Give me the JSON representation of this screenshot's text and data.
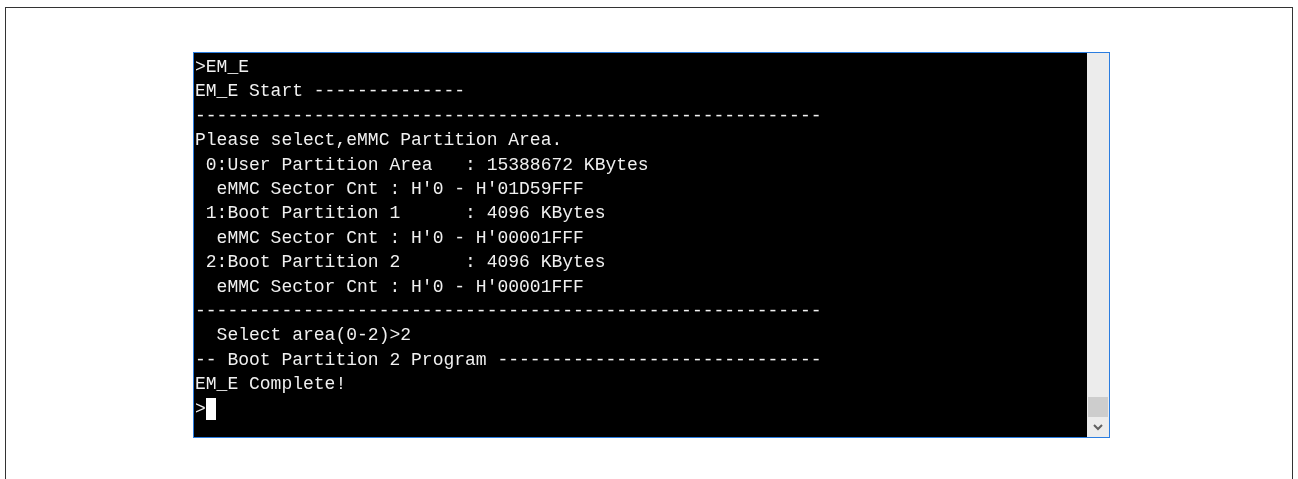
{
  "console": {
    "lines": [
      ">EM_E",
      "EM_E Start --------------",
      "----------------------------------------------------------",
      "Please select,eMMC Partition Area.",
      " 0:User Partition Area   : 15388672 KBytes",
      "  eMMC Sector Cnt : H'0 - H'01D59FFF",
      " 1:Boot Partition 1      : 4096 KBytes",
      "  eMMC Sector Cnt : H'0 - H'00001FFF",
      " 2:Boot Partition 2      : 4096 KBytes",
      "  eMMC Sector Cnt : H'0 - H'00001FFF",
      "----------------------------------------------------------",
      "  Select area(0-2)>2",
      "-- Boot Partition 2 Program ------------------------------",
      "EM_E Complete!"
    ],
    "prompt": ">"
  }
}
